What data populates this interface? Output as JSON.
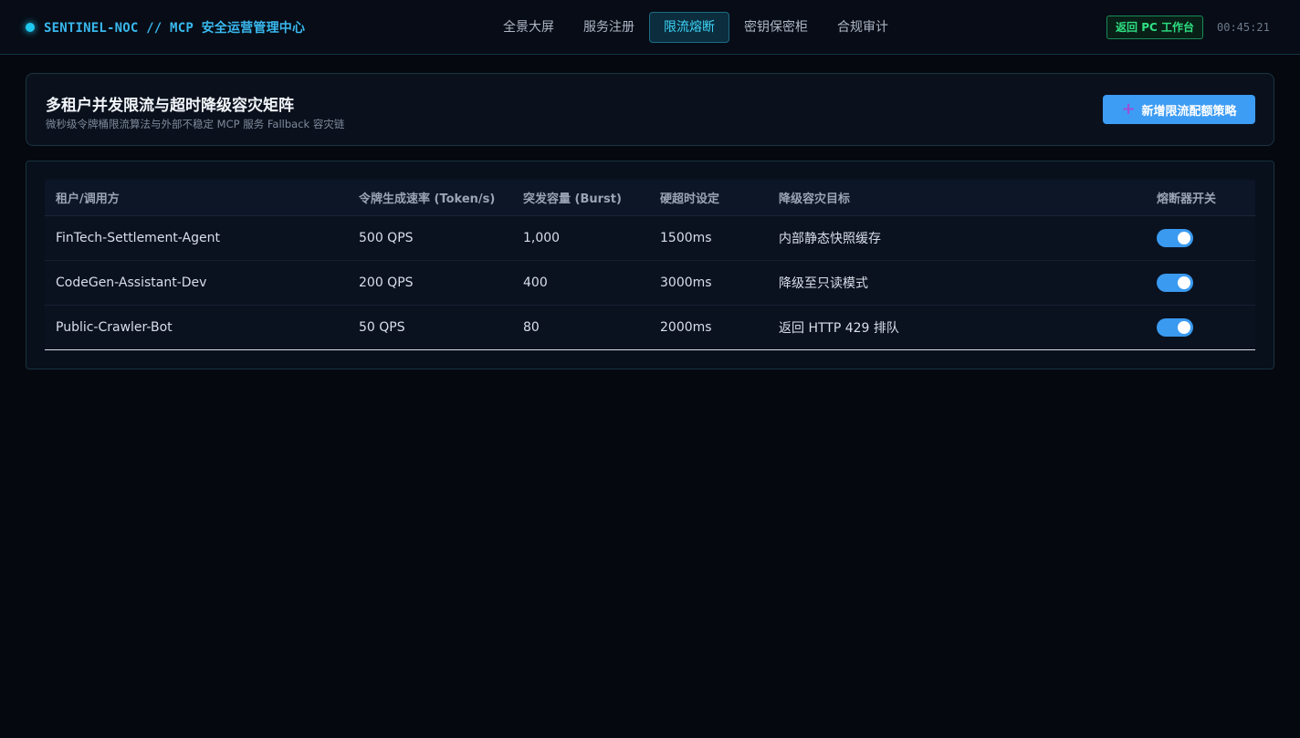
{
  "brand": {
    "title": "SENTINEL-NOC // MCP 安全运营管理中心"
  },
  "nav": {
    "tabs": [
      {
        "label": "全景大屏"
      },
      {
        "label": "服务注册"
      },
      {
        "label": "限流熔断"
      },
      {
        "label": "密钥保密柜"
      },
      {
        "label": "合规审计"
      }
    ],
    "active_tab": "限流熔断"
  },
  "topbar": {
    "pc_button_label": "返回 PC 工作台",
    "clock": "00:45:21"
  },
  "panel": {
    "title": "多租户并发限流与超时降级容灾矩阵",
    "subtitle": "微秒级令牌桶限流算法与外部不稳定 MCP 服务 Fallback 容灾链",
    "add_button_label": "新增限流配额策略"
  },
  "table": {
    "headers": {
      "tenant": "租户/调用方",
      "rate": "令牌生成速率 (Token/s)",
      "burst": "突发容量 (Burst)",
      "timeout": "硬超时设定",
      "fallback": "降级容灾目标",
      "breaker": "熔断器开关"
    },
    "rows": [
      {
        "tenant": "FinTech-Settlement-Agent",
        "rate": "500 QPS",
        "burst": "1,000",
        "timeout": "1500ms",
        "fallback": "内部静态快照缓存",
        "breaker_on": true
      },
      {
        "tenant": "CodeGen-Assistant-Dev",
        "rate": "200 QPS",
        "burst": "400",
        "timeout": "3000ms",
        "fallback": "降级至只读模式",
        "breaker_on": true
      },
      {
        "tenant": "Public-Crawler-Bot",
        "rate": "50 QPS",
        "burst": "80",
        "timeout": "2000ms",
        "fallback": "返回 HTTP 429 排队",
        "breaker_on": true
      }
    ]
  },
  "colors": {
    "accent": "#1fc8ee",
    "primary_button": "#3d9cf4",
    "success": "#2fe082",
    "background": "#05080f"
  },
  "icons": {
    "brand_indicator": "status-dot-icon",
    "add": "plus-icon"
  }
}
